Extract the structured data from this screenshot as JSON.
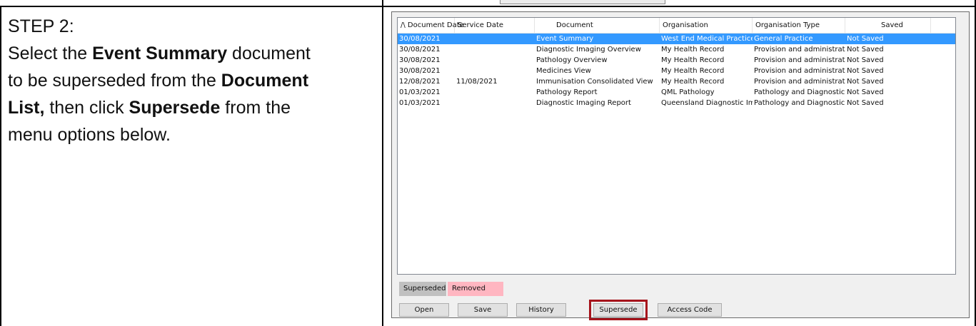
{
  "instructions": {
    "step_label": "STEP 2:",
    "line1_pre": "Select the ",
    "line1_bold": "Event Summary",
    "line1_post": " document",
    "line2_pre": "to be superseded from the ",
    "line2_bold": "Document",
    "line3_bold": "List,",
    "line3_mid": " then click ",
    "line3_bold2": "Supersede",
    "line3_post": " from the",
    "line4": "menu options below."
  },
  "document_list": {
    "columns": [
      "/\\  Document Date",
      "Service Date",
      "Document",
      "Organisation",
      "Organisation Type",
      "Saved",
      ""
    ],
    "rows": [
      {
        "document_date": "30/08/2021",
        "service_date": "",
        "document": "Event Summary",
        "organisation": "West End Medical Practice",
        "organisation_type": "General Practice",
        "saved": "Not Saved",
        "selected": true
      },
      {
        "document_date": "30/08/2021",
        "service_date": "",
        "document": "Diagnostic Imaging Overview",
        "organisation": "My Health Record",
        "organisation_type": "Provision and administration of",
        "saved": "Not Saved",
        "selected": false
      },
      {
        "document_date": "30/08/2021",
        "service_date": "",
        "document": "Pathology Overview",
        "organisation": "My Health Record",
        "organisation_type": "Provision and administration of",
        "saved": "Not Saved",
        "selected": false
      },
      {
        "document_date": "30/08/2021",
        "service_date": "",
        "document": "Medicines View",
        "organisation": "My Health Record",
        "organisation_type": "Provision and administration of",
        "saved": "Not Saved",
        "selected": false
      },
      {
        "document_date": "12/08/2021",
        "service_date": "11/08/2021",
        "document": "Immunisation Consolidated View",
        "organisation": "My Health Record",
        "organisation_type": "Provision and administration of",
        "saved": "Not Saved",
        "selected": false
      },
      {
        "document_date": "01/03/2021",
        "service_date": "",
        "document": "Pathology Report",
        "organisation": "QML Pathology",
        "organisation_type": "Pathology and Diagnostic Imag",
        "saved": "Not Saved",
        "selected": false
      },
      {
        "document_date": "01/03/2021",
        "service_date": "",
        "document": "Diagnostic Imaging Report",
        "organisation": "Queensland Diagnostic Imaging",
        "organisation_type": "Pathology and Diagnostic Imag",
        "saved": "Not Saved",
        "selected": false
      }
    ]
  },
  "legend": {
    "superseded": "Superseded",
    "removed": "Removed",
    "superseded_color": "#c0c0c0",
    "removed_color": "#ffb6c1"
  },
  "buttons": {
    "open": "Open",
    "save": "Save",
    "history": "History",
    "supersede": "Supersede",
    "access_code": "Access Code"
  },
  "colors": {
    "selection": "#3399ff",
    "highlight": "#a6141c"
  }
}
